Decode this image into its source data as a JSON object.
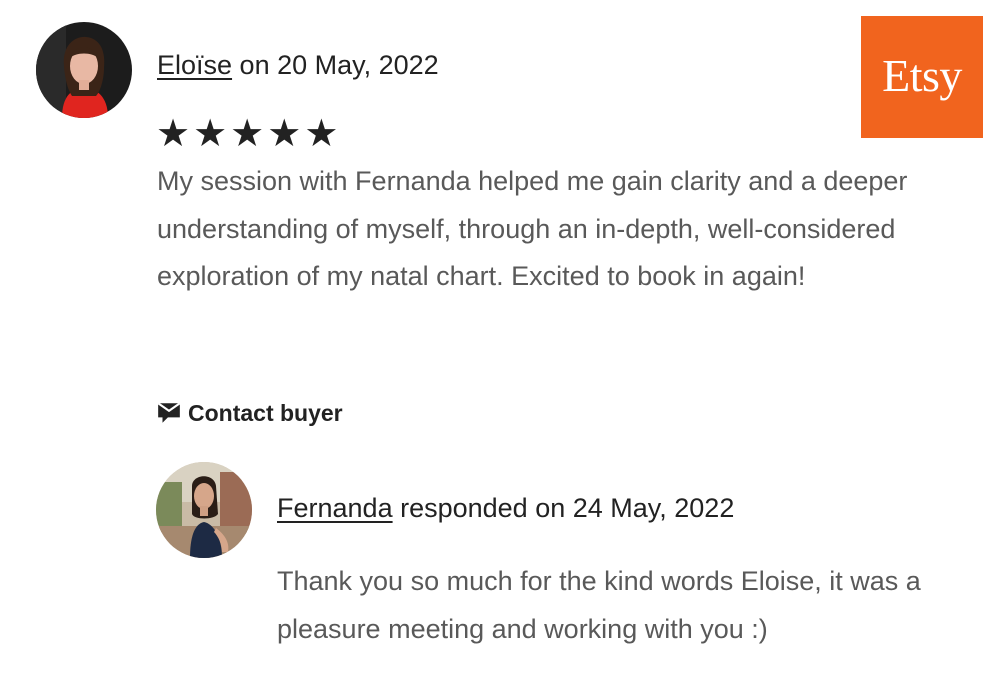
{
  "review": {
    "reviewer_name": "Eloïse",
    "date_text": " on 20 May, 2022",
    "rating": 5,
    "stars": [
      "★",
      "★",
      "★",
      "★",
      "★"
    ],
    "text": "My session with Fernanda helped me gain clarity and a deeper understanding of myself, through an in-depth, well-considered exploration of my natal chart. Excited to book in again!"
  },
  "brand": {
    "logo_text": "Etsy",
    "color": "#f1641e"
  },
  "actions": {
    "contact_label": "Contact buyer",
    "contact_icon": "message-icon"
  },
  "response": {
    "seller_name": "Fernanda",
    "date_text": " responded on 24 May, 2022",
    "text": "Thank you so much for the kind words Eloise, it was a pleasure meeting and working with you :)"
  },
  "colors": {
    "text_primary": "#222222",
    "text_secondary": "#595959"
  }
}
